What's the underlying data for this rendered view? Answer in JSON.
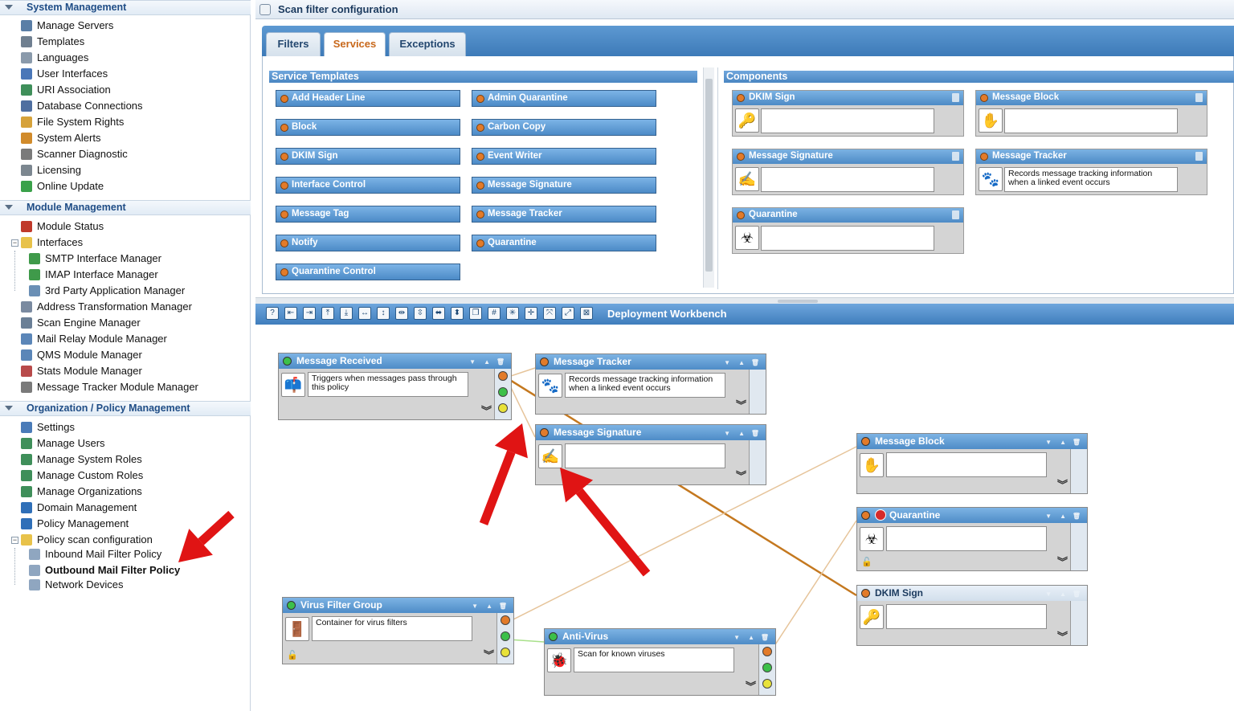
{
  "sidebar": {
    "sections": [
      {
        "title": "System Management"
      },
      {
        "title": "Module Management"
      },
      {
        "title": "Organization / Policy Management"
      }
    ],
    "system_items": [
      {
        "label": "Manage Servers",
        "icon": "server-icon",
        "color": "#5a7ea6"
      },
      {
        "label": "Templates",
        "icon": "document-icon",
        "color": "#6f7f90"
      },
      {
        "label": "Languages",
        "icon": "speech-bubble-icon",
        "color": "#8a9aab"
      },
      {
        "label": "User Interfaces",
        "icon": "interface-icon",
        "color": "#4a77b8"
      },
      {
        "label": "URI Association",
        "icon": "globe-icon",
        "color": "#3f8f5a"
      },
      {
        "label": "Database Connections",
        "icon": "database-icon",
        "color": "#4f6fa0"
      },
      {
        "label": "File System Rights",
        "icon": "folder-key-icon",
        "color": "#d6a23a"
      },
      {
        "label": "System Alerts",
        "icon": "alert-icon",
        "color": "#d18b2b"
      },
      {
        "label": "Scanner Diagnostic",
        "icon": "scanner-icon",
        "color": "#7a7a7a"
      },
      {
        "label": "Licensing",
        "icon": "license-icon",
        "color": "#7c8790"
      },
      {
        "label": "Online Update",
        "icon": "update-globe-icon",
        "color": "#3aa14a"
      }
    ],
    "module_items": [
      {
        "label": "Module Status",
        "icon": "traffic-light-icon",
        "color": "#c0392b",
        "level": 0
      },
      {
        "label": "Interfaces",
        "icon": "folder-icon",
        "color": "#e8c24a",
        "level": 0,
        "toggle": "−"
      },
      {
        "label": "SMTP Interface Manager",
        "icon": "plugin-icon",
        "color": "#3f9a4a",
        "level": 1
      },
      {
        "label": "IMAP Interface Manager",
        "icon": "plugin-icon",
        "color": "#3f9a4a",
        "level": 1
      },
      {
        "label": "3rd Party Application Manager",
        "icon": "plugin-icon",
        "color": "#6a8fb5",
        "level": 1
      },
      {
        "label": "Address Transformation Manager",
        "icon": "transform-icon",
        "color": "#7a8aa0",
        "level": 0
      },
      {
        "label": "Scan Engine Manager",
        "icon": "engine-icon",
        "color": "#6a7f96",
        "level": 0
      },
      {
        "label": "Mail Relay Module Manager",
        "icon": "relay-icon",
        "color": "#5b86b8",
        "level": 0
      },
      {
        "label": "QMS Module Manager",
        "icon": "qms-icon",
        "color": "#5b86b8",
        "level": 0
      },
      {
        "label": "Stats Module Manager",
        "icon": "stats-icon",
        "color": "#b84a4a",
        "level": 0
      },
      {
        "label": "Message Tracker Module Manager",
        "icon": "tracker-icon",
        "color": "#7a7a7a",
        "level": 0
      }
    ],
    "org_items": [
      {
        "label": "Settings",
        "icon": "settings-icon",
        "color": "#4a7bb8",
        "level": 0
      },
      {
        "label": "Manage Users",
        "icon": "users-icon",
        "color": "#3f8f5a",
        "level": 0
      },
      {
        "label": "Manage System Roles",
        "icon": "roles-icon",
        "color": "#3f8f5a",
        "level": 0
      },
      {
        "label": "Manage Custom Roles",
        "icon": "roles-icon",
        "color": "#3f8f5a",
        "level": 0
      },
      {
        "label": "Manage Organizations",
        "icon": "organizations-icon",
        "color": "#3f8f5a",
        "level": 0
      },
      {
        "label": "Domain Management",
        "icon": "domain-globe-icon",
        "color": "#2f6fb8",
        "level": 0
      },
      {
        "label": "Policy Management",
        "icon": "policy-icon",
        "color": "#2f6fb8",
        "level": 0
      },
      {
        "label": "Policy scan configuration",
        "icon": "folder-icon",
        "color": "#e8c24a",
        "level": 0,
        "toggle": "−"
      },
      {
        "label": "Inbound Mail Filter Policy",
        "icon": "filter-policy-icon",
        "color": "#8fa6c0",
        "level": 1
      },
      {
        "label": "Outbound Mail Filter Policy",
        "icon": "filter-policy-icon",
        "color": "#8fa6c0",
        "level": 1,
        "bold": true
      },
      {
        "label": "Network Devices",
        "icon": "filter-policy-icon",
        "color": "#8fa6c0",
        "level": 1
      }
    ]
  },
  "top_panel": {
    "title": "Scan filter configuration",
    "tabs": [
      {
        "label": "Filters"
      },
      {
        "label": "Services",
        "active": true
      },
      {
        "label": "Exceptions"
      }
    ]
  },
  "service_templates": {
    "title": "Service  Templates",
    "items": [
      {
        "label": "Add Header Line"
      },
      {
        "label": "Admin Quarantine"
      },
      {
        "label": "Block"
      },
      {
        "label": "Carbon Copy"
      },
      {
        "label": "DKIM Sign"
      },
      {
        "label": "Event Writer"
      },
      {
        "label": "Interface Control"
      },
      {
        "label": "Message Signature"
      },
      {
        "label": "Message Tag"
      },
      {
        "label": "Message Tracker"
      },
      {
        "label": "Notify"
      },
      {
        "label": "Quarantine"
      },
      {
        "label": "Quarantine Control"
      }
    ]
  },
  "components": {
    "title": "Components",
    "items": [
      {
        "title": "DKIM Sign",
        "icon": "dkim-key-icon",
        "glyph": "🔑",
        "desc": ""
      },
      {
        "title": "Message Block",
        "icon": "stop-hand-icon",
        "glyph": "✋",
        "desc": ""
      },
      {
        "title": "Message Signature",
        "icon": "signature-hand-icon",
        "glyph": "✍",
        "desc": ""
      },
      {
        "title": "Message Tracker",
        "icon": "paw-print-icon",
        "glyph": "🐾",
        "desc": "Records message tracking information\nwhen a linked event occurs"
      },
      {
        "title": "Quarantine",
        "icon": "biohazard-icon",
        "glyph": "☣",
        "desc": ""
      }
    ]
  },
  "workbench": {
    "title": "Deployment Workbench",
    "toolbar": [
      {
        "icon": "help-icon",
        "glyph": "?"
      },
      {
        "icon": "align-left-icon",
        "glyph": "⇤"
      },
      {
        "icon": "align-right-icon",
        "glyph": "⇥"
      },
      {
        "icon": "align-top-icon",
        "glyph": "⤒"
      },
      {
        "icon": "align-bottom-icon",
        "glyph": "⤓"
      },
      {
        "icon": "center-horizontal-icon",
        "glyph": "↔"
      },
      {
        "icon": "center-vertical-icon",
        "glyph": "↕"
      },
      {
        "icon": "distribute-h-icon",
        "glyph": "⇹"
      },
      {
        "icon": "distribute-v-icon",
        "glyph": "⇳"
      },
      {
        "icon": "same-width-icon",
        "glyph": "⬌"
      },
      {
        "icon": "same-height-icon",
        "glyph": "⬍"
      },
      {
        "icon": "bring-front-icon",
        "glyph": "❐"
      },
      {
        "icon": "grid-icon",
        "glyph": "#"
      },
      {
        "icon": "snap-icon",
        "glyph": "✳"
      },
      {
        "icon": "collapse-icon",
        "glyph": "✛"
      },
      {
        "icon": "fit-icon",
        "glyph": "⤧"
      },
      {
        "icon": "expand-icon",
        "glyph": "⤢"
      },
      {
        "icon": "delete-all-icon",
        "glyph": "⊠"
      }
    ],
    "nodes": [
      {
        "title": "Message Received",
        "icon": "mailbox-icon",
        "glyph": "📫",
        "desc": "Triggers when messages pass through\nthis policy",
        "head_dot": "#3cc04a",
        "ports": true
      },
      {
        "title": "Message Tracker",
        "icon": "paw-print-icon",
        "glyph": "🐾",
        "desc": "Records message tracking information\nwhen a linked event occurs",
        "head_dot": "#e27b2a",
        "ports": false
      },
      {
        "title": "Message Signature",
        "icon": "signature-hand-icon",
        "glyph": "✍",
        "desc": "",
        "head_dot": "#e27b2a",
        "ports": false
      },
      {
        "title": "Message Block",
        "icon": "stop-hand-icon",
        "glyph": "✋",
        "desc": "",
        "head_dot": "#e27b2a",
        "ports": false
      },
      {
        "title": "Quarantine",
        "icon": "biohazard-icon",
        "glyph": "☣",
        "desc": "",
        "head_dot": "#e27b2a",
        "ports": false,
        "extra_icon": true,
        "lock": true
      },
      {
        "title": "DKIM Sign",
        "icon": "dkim-key-icon",
        "glyph": "🔑",
        "desc": "",
        "head_dot": "#e27b2a",
        "ports": false,
        "plain": true
      },
      {
        "title": "Virus Filter Group",
        "icon": "door-icon",
        "glyph": "🚪",
        "desc": "Container for virus filters",
        "head_dot": "#3cc04a",
        "ports": true,
        "lock": true
      },
      {
        "title": "Anti-Virus",
        "icon": "no-bug-icon",
        "glyph": "🐞",
        "desc": "Scan for known viruses",
        "head_dot": "#3cc04a",
        "ports": true
      }
    ]
  },
  "colors": {
    "accent_blue": "#4a86c2",
    "port_orange": "#e27b2a",
    "port_green": "#3cc04a",
    "port_yellow": "#e8e23a",
    "link_dark": "#c4781f",
    "link_light": "#e6c49a",
    "arrow_red": "#e01414"
  }
}
